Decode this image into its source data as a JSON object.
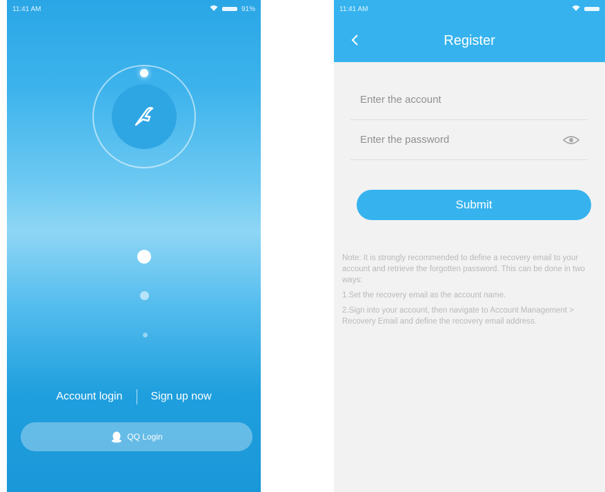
{
  "left_screen": {
    "status": {
      "time": "11:41 AM",
      "battery": "91%"
    },
    "account_login": "Account login",
    "sign_up_now": "Sign up now",
    "qq_login": "QQ Login"
  },
  "right_screen": {
    "status": {
      "time": "11:41 AM"
    },
    "title": "Register",
    "account_placeholder": "Enter the account",
    "password_placeholder": "Enter the password",
    "submit": "Submit",
    "note": "Note: It is strongly recommended to define a recovery email to your account and retrieve the forgotten password. This can be done in two ways:",
    "step1": "1.Set the recovery email as the account name.",
    "step2": "2.Sign into your account, then navigate to Account Management > Recovery Email and define the recovery email address."
  },
  "colors": {
    "accent": "#36b3ee",
    "left_bg_top": "#2aa6e6",
    "left_bg_bottom": "#1a97d8",
    "right_bg": "#f2f2f2"
  },
  "icons": [
    "wifi-icon",
    "battery-icon",
    "app-logo-icon",
    "qq-penguin-icon",
    "back-arrow-icon",
    "eye-icon"
  ]
}
